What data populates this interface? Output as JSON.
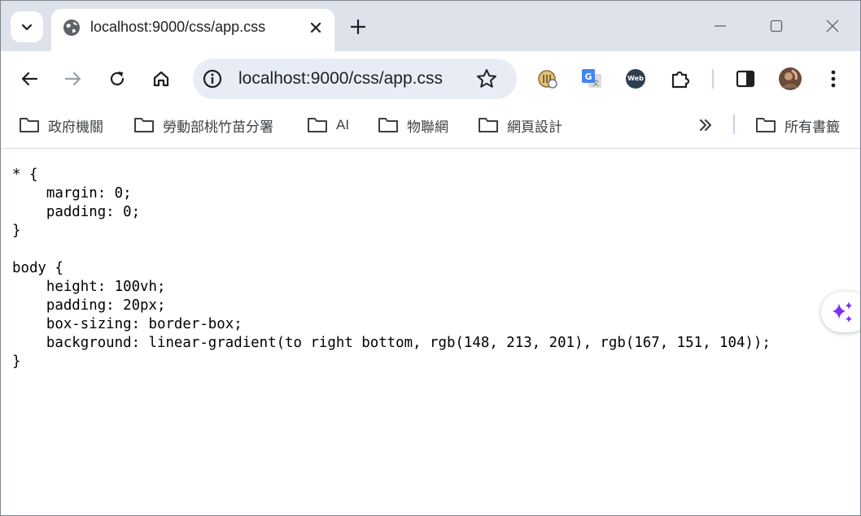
{
  "tab": {
    "title": "localhost:9000/css/app.css"
  },
  "omnibox": {
    "url": "localhost:9000/css/app.css"
  },
  "bookmarks": {
    "items": [
      "政府機關",
      "勞動部桃竹苗分署",
      "AI",
      "物聯網",
      "網頁設計"
    ],
    "all_bookmarks": "所有書籤"
  },
  "extensions": {
    "web_chatgpt_badge": "Web"
  },
  "content": {
    "code": "* {\n    margin: 0;\n    padding: 0;\n}\n\nbody {\n    height: 100vh;\n    padding: 20px;\n    box-sizing: border-box;\n    background: linear-gradient(to right bottom, rgb(148, 213, 201), rgb(167, 151, 104));\n}"
  },
  "colors": {
    "tabstrip": "#dee3eb",
    "omnibox": "#e8edf5",
    "icon": "#444746",
    "accent_sparkle": "#7b2ff7"
  }
}
